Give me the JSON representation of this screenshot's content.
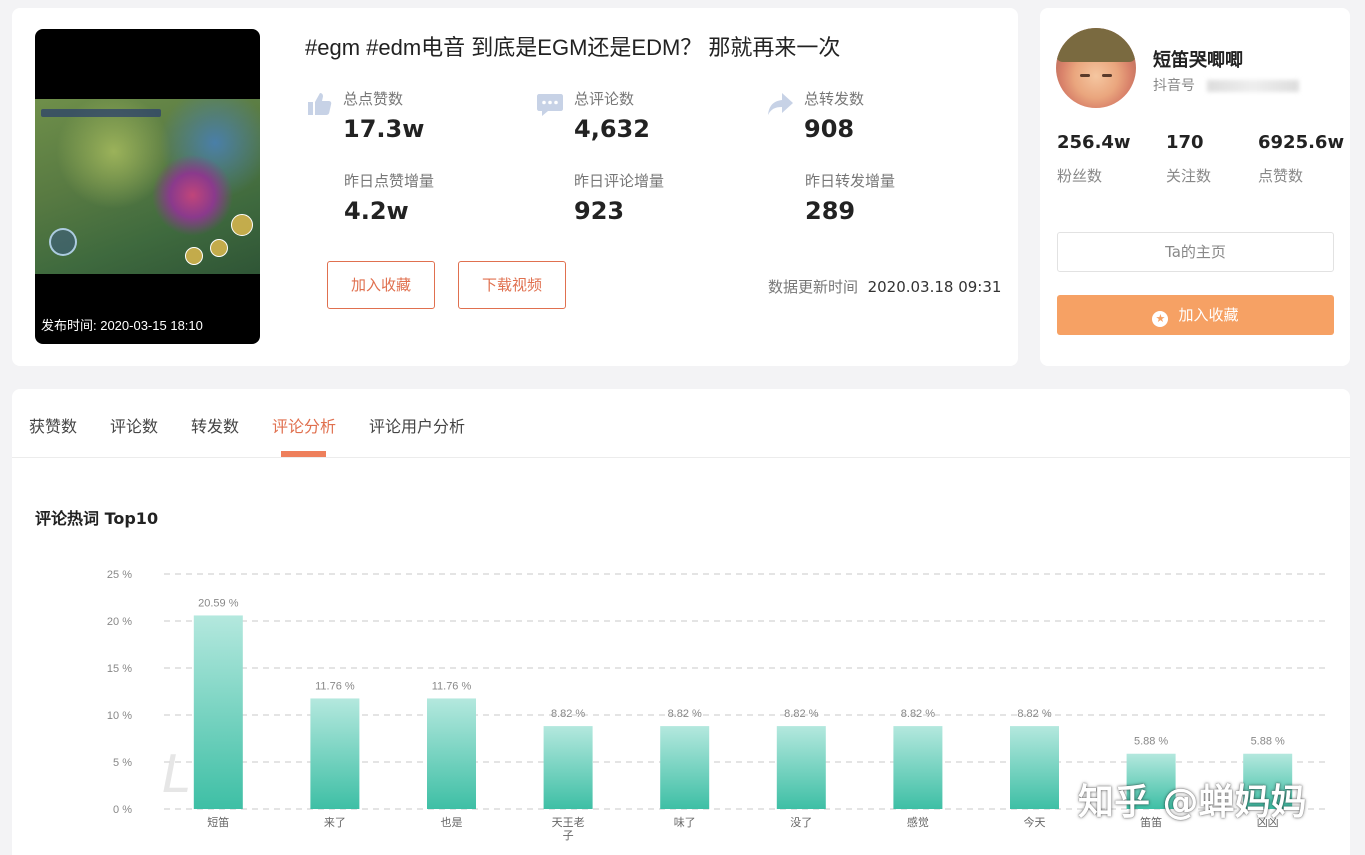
{
  "video": {
    "title": "#egm #edm电音 到底是EGM还是EDM？ 那就再来一次",
    "publish_time": "发布时间:   2020-03-15 18:10",
    "stats": [
      {
        "label": "总点赞数",
        "value": "17.3w",
        "icon": "thumb-up-icon"
      },
      {
        "label": "总评论数",
        "value": "4,632",
        "icon": "comment-icon"
      },
      {
        "label": "总转发数",
        "value": "908",
        "icon": "share-icon"
      },
      {
        "label": "昨日点赞增量",
        "value": "4.2w"
      },
      {
        "label": "昨日评论增量",
        "value": "923"
      },
      {
        "label": "昨日转发增量",
        "value": "289"
      }
    ],
    "buttons": {
      "favorite": "加入收藏",
      "download": "下载视频"
    },
    "update_label": "数据更新时间",
    "update_time": "2020.03.18 09:31"
  },
  "user": {
    "name": "短笛哭唧唧",
    "id_label": "抖音号",
    "stats": [
      {
        "value": "256.4w",
        "label": "粉丝数"
      },
      {
        "value": "170",
        "label": "关注数"
      },
      {
        "value": "6925.6w",
        "label": "点赞数"
      }
    ],
    "home_button": "Ta的主页",
    "favorite_button": "加入收藏"
  },
  "tabs": [
    "获赞数",
    "评论数",
    "转发数",
    "评论分析",
    "评论用户分析"
  ],
  "active_tab": 3,
  "chart_title": "评论热词 Top10",
  "watermarks": {
    "left": "L",
    "right": "知乎 @蝉妈妈"
  },
  "colors": {
    "accent": "#e0704f",
    "orange_button": "#f6a164",
    "bar_top": "#b4e8de",
    "bar_bottom": "#3ebfa5"
  },
  "chart_data": {
    "type": "bar",
    "title": "评论热词 Top10",
    "categories": [
      "短笛",
      "来了",
      "也是",
      "天王老子",
      "味了",
      "没了",
      "感觉",
      "今天",
      "笛笛",
      "凶凶"
    ],
    "values": [
      20.59,
      11.76,
      11.76,
      8.82,
      8.82,
      8.82,
      8.82,
      8.82,
      5.88,
      5.88
    ],
    "data_labels": [
      "20.59 %",
      "11.76 %",
      "11.76 %",
      "8.82 %",
      "8.82 %",
      "8.82 %",
      "8.82 %",
      "8.82 %",
      "5.88 %",
      "5.88 %"
    ],
    "y_ticks": [
      "0 %",
      "5 %",
      "10 %",
      "15 %",
      "20 %",
      "25 %"
    ],
    "ylim": [
      0,
      25
    ],
    "grid": true,
    "unit": "%"
  }
}
